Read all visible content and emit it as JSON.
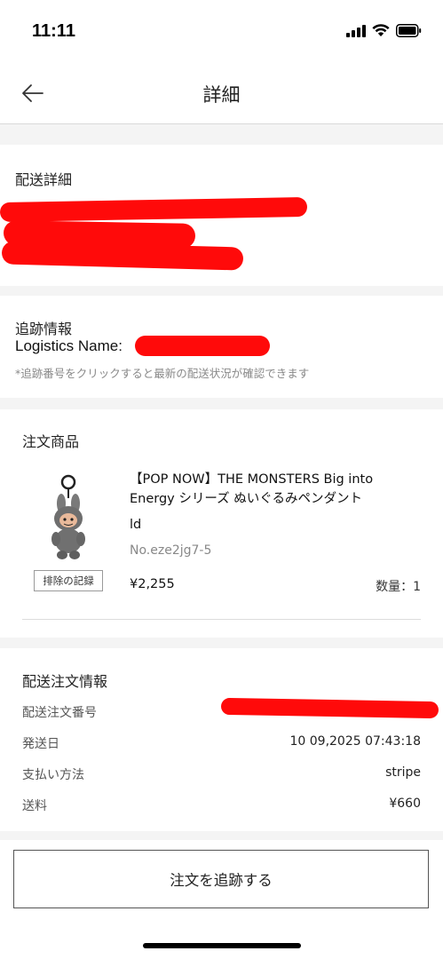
{
  "status_bar": {
    "time": "11:11"
  },
  "header": {
    "title": "詳細"
  },
  "delivery_details": {
    "title": "配送詳細"
  },
  "tracking_info": {
    "title": "追跡情報",
    "logistics_label": "Logistics Name:",
    "note": "*追跡番号をクリックすると最新の配送状況が確認できます"
  },
  "order_items": {
    "title": "注文商品",
    "product": {
      "name_line1": "【POP NOW】THE MONSTERS Big into",
      "name_line2": "Energy シリーズ ぬいぐるみペンダント",
      "name_line3": "ld",
      "sku": "No.eze2jg7-5",
      "price": "¥2,255",
      "quantity": "数量：1",
      "exclude_label": "排除の記録"
    }
  },
  "shipping_info": {
    "title": "配送注文情報",
    "rows": [
      {
        "label": "配送注文番号",
        "value": ""
      },
      {
        "label": "発送日",
        "value": "10 09,2025 07:43:18"
      },
      {
        "label": "支払い方法",
        "value": "stripe"
      },
      {
        "label": "送料",
        "value": "¥660"
      }
    ]
  },
  "actions": {
    "track_order": "注文を追跡する"
  },
  "colors": {
    "redaction": "#ff0a0a",
    "background": "#f4f4f4"
  }
}
